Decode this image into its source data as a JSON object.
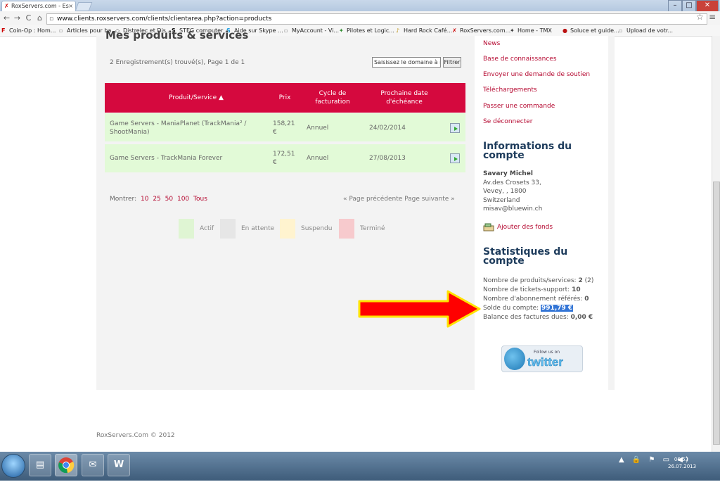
{
  "browser": {
    "tab_title": "RoxServers.com - Es",
    "tab_close": "×",
    "url": "www.clients.roxservers.com/clients/clientarea.php?action=products",
    "back": "←",
    "forward": "→",
    "reload": "C",
    "home": "⌂",
    "star": "☆",
    "wrench": "≡",
    "minimize": "–",
    "restore": "□",
    "close": "✕",
    "bookmarks": [
      {
        "label": "Coin-Op : Hom..."
      },
      {
        "label": "Articles pour ba..."
      },
      {
        "label": "Distrelec et Dis..."
      },
      {
        "label": "STEG computer ..."
      },
      {
        "label": "Aide sur Skype ..."
      },
      {
        "label": "MyAccount - Vi..."
      },
      {
        "label": "Pilotes et Logic..."
      },
      {
        "label": "Hard Rock Café..."
      },
      {
        "label": "RoxServers.com..."
      },
      {
        "label": "Home - TMX"
      },
      {
        "label": "Soluce et guide..."
      },
      {
        "label": "Upload de votr..."
      }
    ]
  },
  "main": {
    "title": "Mes produits & services",
    "record_count": "2 Enregistrement(s) trouvé(s), Page 1 de 1",
    "domain_placeholder": "Saisissez le domaine à re",
    "filter_label": "Filtrer",
    "table": {
      "headers": [
        "Produit/Service ▲",
        "Prix",
        "Cycle de facturation",
        "Prochaine date d'échéance"
      ],
      "rows": [
        {
          "product": "Game Servers - ManiaPlanet (TrackMania² / ShootMania)",
          "price": "158,21 €",
          "cycle": "Annuel",
          "due": "24/02/2014"
        },
        {
          "product": "Game Servers - TrackMania Forever",
          "price": "172,51 €",
          "cycle": "Annuel",
          "due": "27/08/2013"
        }
      ]
    },
    "show_label": "Montrer:",
    "show_options": [
      "10",
      "25",
      "50",
      "100",
      "Tous"
    ],
    "pager": "« Page précédente  Page suivante »",
    "legend": [
      {
        "label": "Actif",
        "color": "#dff5d3"
      },
      {
        "label": "En attente",
        "color": "#e6e6e6"
      },
      {
        "label": "Suspendu",
        "color": "#fff3cf"
      },
      {
        "label": "Terminé",
        "color": "#f7cacd"
      }
    ],
    "footer": "RoxServers.Com © 2012"
  },
  "sidebar": {
    "links": [
      "News",
      "Base de connaissances",
      "Envoyer une demande de soutien",
      "Téléchargements",
      "Passer une commande",
      "Se déconnecter"
    ],
    "account_heading": "Informations du compte",
    "account": {
      "name": "Savary Michel",
      "address": [
        "Av.des Crosets 33,",
        "Vevey, , 1800",
        "Switzerland",
        "misav@bluewin.ch"
      ]
    },
    "add_funds": "Ajouter des fonds",
    "stats_heading": "Statistiques du compte",
    "stats": {
      "products_label": "Nombre de produits/services:",
      "products_value": "2",
      "products_extra": "(2)",
      "tickets_label": "Nombre de tickets-support:",
      "tickets_value": "10",
      "referrals_label": "Nombre d'abonnement référés:",
      "referrals_value": "0",
      "balance_label": "Solde du compte:",
      "balance_value": "991,79 €",
      "invoices_label": "Balance des factures dues:",
      "invoices_value": "0,00 €"
    },
    "twitter_follow": "Follow us on",
    "twitter_word": "twitter"
  },
  "taskbar": {
    "tray": "▲ 🔒 ⚑ ▭ ◀)",
    "time": "06:53",
    "date": "26.07.2013"
  },
  "colors": {
    "accent": "#d5093e",
    "link": "#b50830",
    "row_bg": "#e2fad7",
    "heading": "#1e3c5c",
    "highlight": "#3375d6"
  }
}
